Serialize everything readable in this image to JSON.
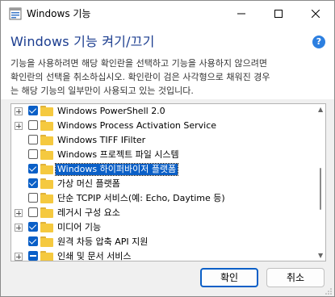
{
  "window": {
    "title": "Windows 기능",
    "app_icon": "windows-features-icon"
  },
  "header": {
    "heading": "Windows 기능 켜기/끄기",
    "help_icon": "help-icon",
    "description_lines": [
      "기능을 사용하려면 해당 확인란을 선택하고 기능을 사용하지 않으려면",
      "확인란의 선택을 취소하십시오. 확인란이 검은 사각형으로 채워진 경우",
      "는 해당 기능의 일부만이 사용되고 있는 것입니다."
    ]
  },
  "features": [
    {
      "label": "Windows PowerShell 2.0",
      "state": "checked",
      "expandable": true,
      "selected": false
    },
    {
      "label": "Windows Process Activation Service",
      "state": "unchecked",
      "expandable": true,
      "selected": false
    },
    {
      "label": "Windows TIFF IFilter",
      "state": "unchecked",
      "expandable": false,
      "selected": false
    },
    {
      "label": "Windows 프로젝트 파일 시스템",
      "state": "unchecked",
      "expandable": false,
      "selected": false
    },
    {
      "label": "Windows 하이퍼바이저 플랫폼",
      "state": "checked",
      "expandable": false,
      "selected": true
    },
    {
      "label": "가상 머신 플랫폼",
      "state": "checked",
      "expandable": false,
      "selected": false
    },
    {
      "label": "단순 TCPIP 서비스(예: Echo, Daytime 등)",
      "state": "unchecked",
      "expandable": false,
      "selected": false
    },
    {
      "label": "레거시 구성 요소",
      "state": "unchecked",
      "expandable": true,
      "selected": false
    },
    {
      "label": "미디어 기능",
      "state": "checked",
      "expandable": true,
      "selected": false
    },
    {
      "label": "원격 차등 압축 API 지원",
      "state": "checked",
      "expandable": false,
      "selected": false
    },
    {
      "label": "인쇄 및 문서 서비스",
      "state": "partial",
      "expandable": true,
      "selected": false
    }
  ],
  "buttons": {
    "ok": "확인",
    "cancel": "취소"
  },
  "colors": {
    "accent": "#0a5fc7",
    "heading": "#1a3c8f",
    "folder": "#f5c93f"
  }
}
